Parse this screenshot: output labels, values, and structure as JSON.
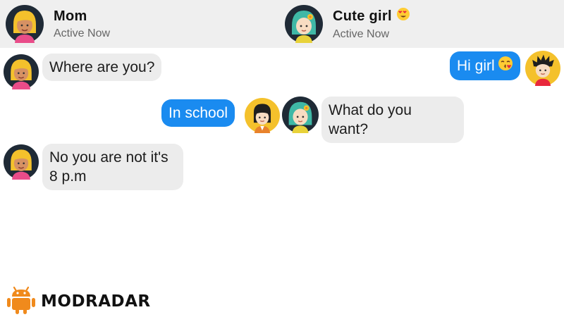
{
  "left_chat": {
    "contact_name": "Mom",
    "status": "Active Now",
    "avatar_icon": "mom-avatar",
    "messages": [
      {
        "from": "Mom",
        "direction": "incoming",
        "text": "Where are you?"
      },
      {
        "from": "me",
        "direction": "outgoing",
        "text": "In school"
      },
      {
        "from": "Mom",
        "direction": "incoming",
        "text_lines": [
          "No you are not it's",
          "8 p.m"
        ]
      }
    ]
  },
  "right_chat": {
    "contact_name": "Cute girl",
    "name_emoji": "heart-eyes-emoji",
    "status": "Active Now",
    "avatar_icon": "girl-avatar",
    "messages": [
      {
        "from": "me",
        "direction": "outgoing",
        "text": "Hi girl",
        "emoji": "kissing-face-emoji"
      },
      {
        "from": "Cute girl",
        "direction": "incoming",
        "text_lines": [
          "What do you",
          "want?"
        ]
      }
    ]
  },
  "colors": {
    "outgoing_bubble": "#1a8bf0",
    "incoming_bubble": "#ececec",
    "header_bg": "#efefef"
  },
  "watermark": {
    "text": "MODRADAR",
    "icon": "android-robot-icon"
  }
}
